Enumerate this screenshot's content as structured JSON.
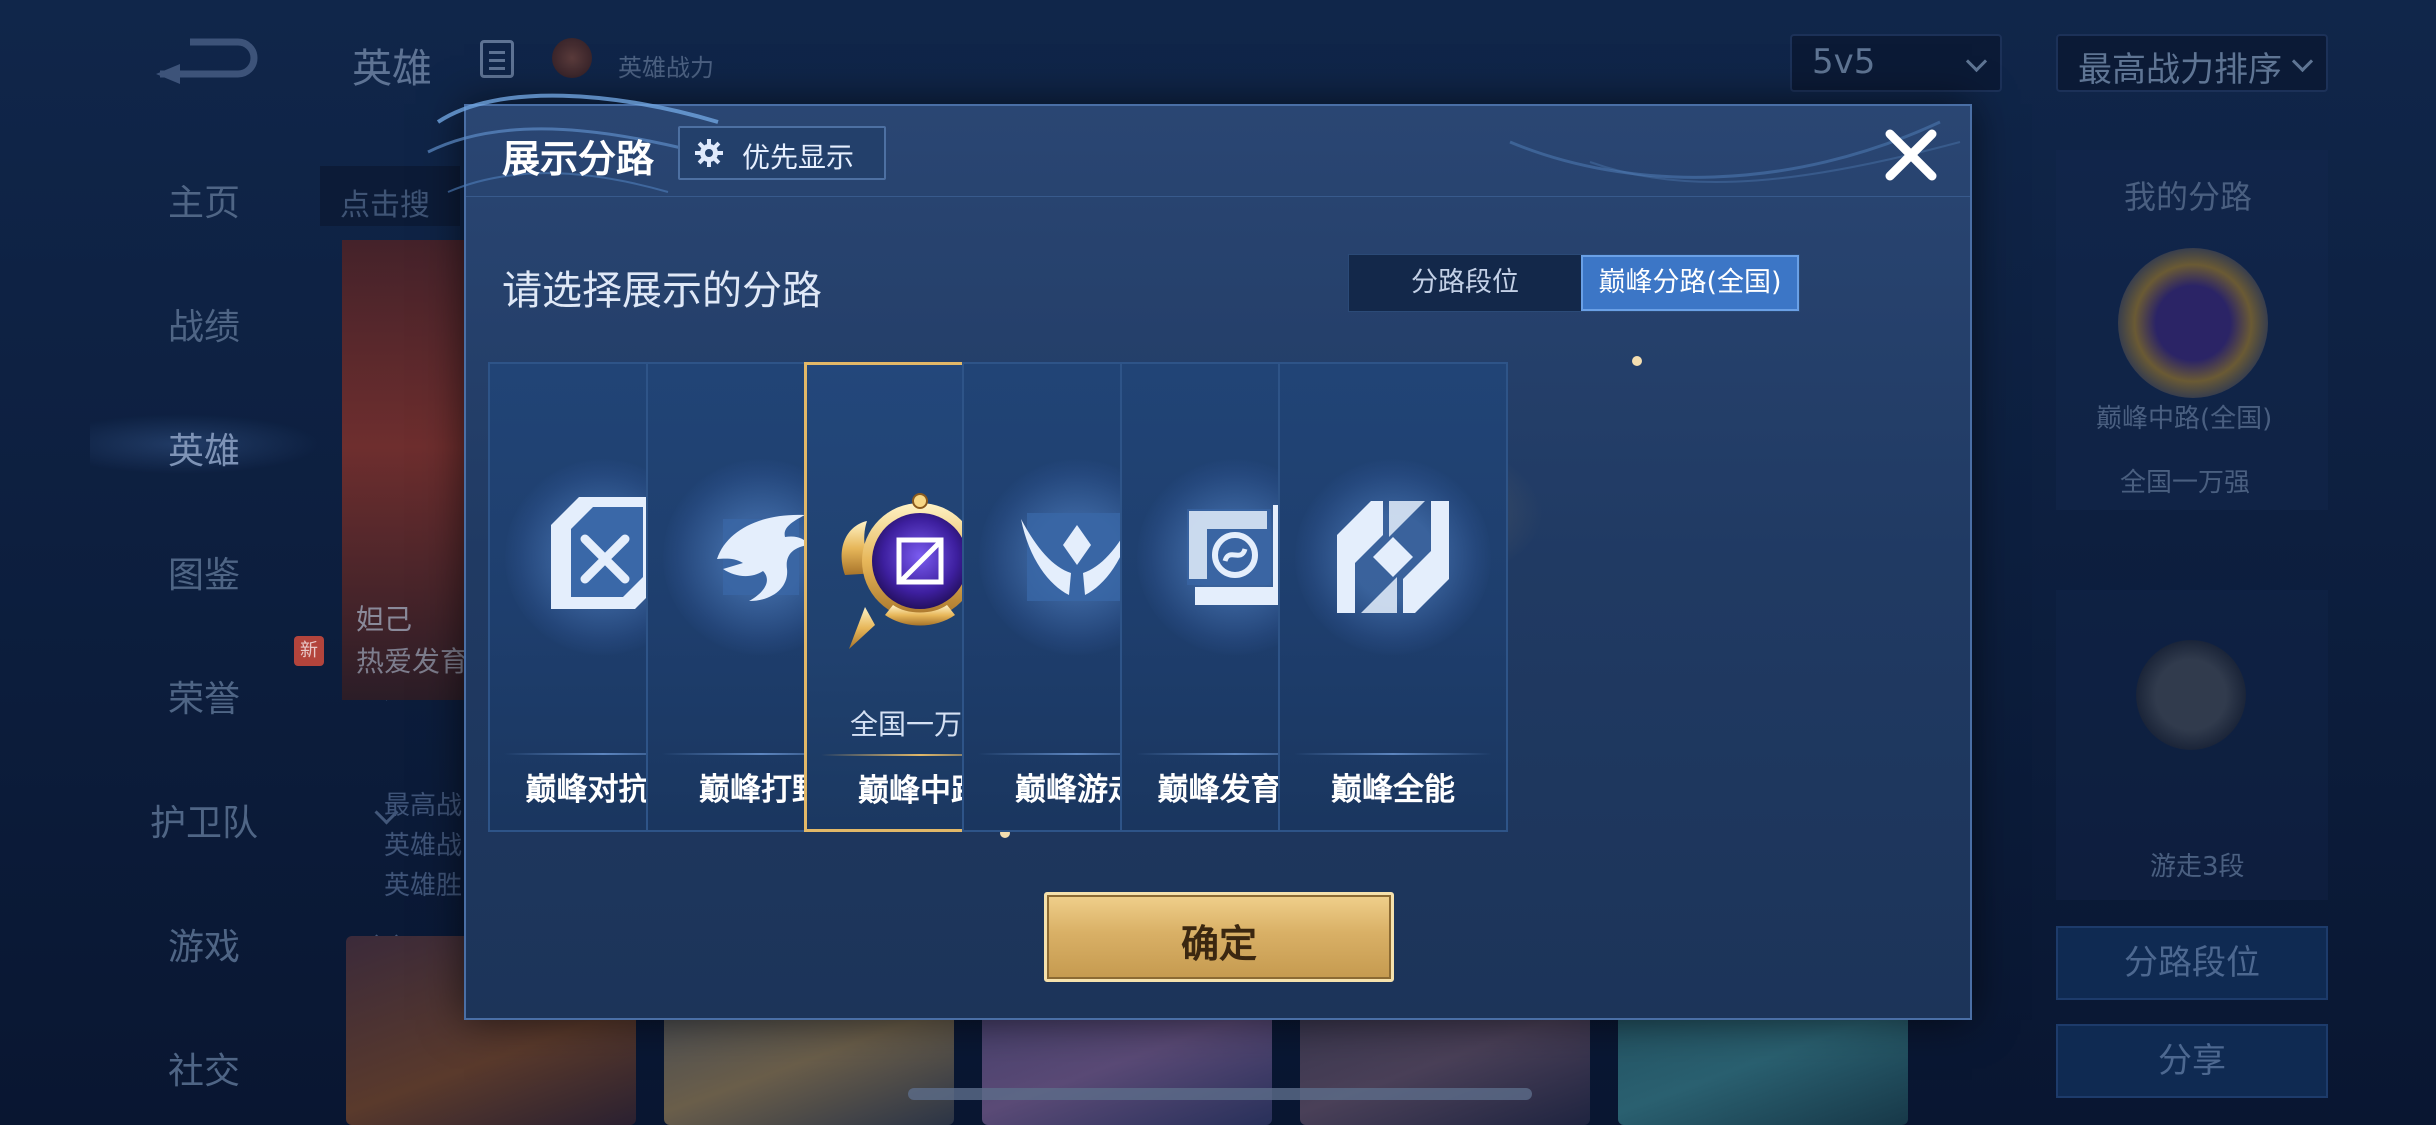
{
  "background": {
    "top_title": "英雄",
    "top_power_label": "英雄战力",
    "mode_select": "5v5",
    "sort_select": "最高战力排序",
    "search_hint": "点击搜",
    "sidebar": [
      {
        "label": "主页",
        "has_chevron": false
      },
      {
        "label": "战绩",
        "has_chevron": false
      },
      {
        "label": "英雄",
        "has_chevron": false,
        "active": true
      },
      {
        "label": "图鉴",
        "has_chevron": true
      },
      {
        "label": "荣誉",
        "has_chevron": true
      },
      {
        "label": "护卫队",
        "has_chevron": true
      },
      {
        "label": "游戏",
        "has_chevron": true
      },
      {
        "label": "社交",
        "has_chevron": true
      }
    ],
    "new_badge": "新",
    "hero_name": "妲己",
    "hero_subtitle": "热爱发育",
    "hero_stats": [
      "最高战",
      "英雄战",
      "英雄胜"
    ],
    "right_panel": {
      "title": "我的分路",
      "lane": "巅峰中路(全国)",
      "rank": "全国一万强",
      "secondary": "游走3段",
      "btn_lane_rank": "分路段位",
      "btn_share": "分享"
    }
  },
  "modal": {
    "title": "展示分路",
    "priority_button": "优先显示",
    "subtitle": "请选择展示的分路",
    "tabs": [
      {
        "label": "分路段位",
        "active": false
      },
      {
        "label": "巅峰分路(全国)",
        "active": true
      }
    ],
    "lanes": [
      {
        "label": "巅峰对抗路",
        "icon": "crossed-swords-icon",
        "selected": false
      },
      {
        "label": "巅峰打野",
        "icon": "dragon-icon",
        "selected": false
      },
      {
        "label": "巅峰中路",
        "icon": "mid-lane-emblem-icon",
        "selected": true,
        "rank": "全国一万强"
      },
      {
        "label": "巅峰游走",
        "icon": "wings-icon",
        "selected": false
      },
      {
        "label": "巅峰发育路",
        "icon": "marksman-icon",
        "selected": false
      },
      {
        "label": "巅峰全能",
        "icon": "all-round-icon",
        "selected": false
      }
    ],
    "confirm_button": "确定"
  },
  "colors": {
    "accent_blue": "#3c76c6",
    "gold": "#d9b066",
    "modal_bg": "#203a63"
  }
}
